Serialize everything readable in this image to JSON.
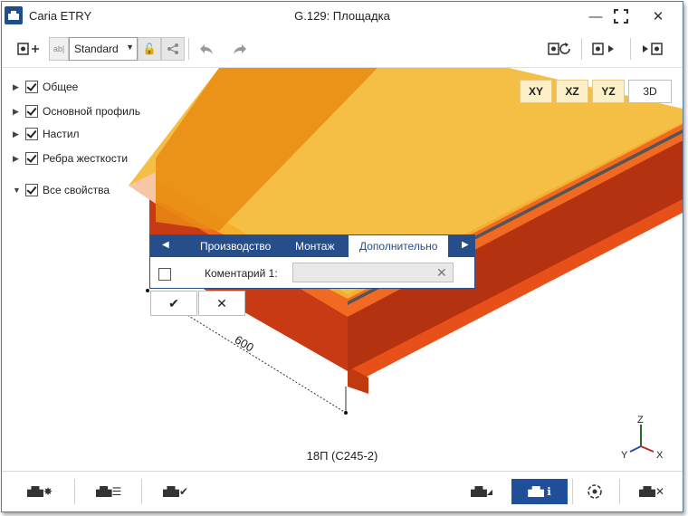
{
  "window": {
    "app_name": "Caria ETRY",
    "title": "G.129: Площадка"
  },
  "toolbar": {
    "style_value": "Standard",
    "ab_label": "ab|"
  },
  "view_buttons": [
    "XY",
    "XZ",
    "YZ",
    "3D"
  ],
  "tree": {
    "items": [
      {
        "label": "Общее",
        "expanded": false,
        "checked": true
      },
      {
        "label": "Основной профиль",
        "expanded": false,
        "checked": true
      },
      {
        "label": "Настил",
        "expanded": false,
        "checked": true
      },
      {
        "label": "Ребра жесткости",
        "expanded": false,
        "checked": true
      },
      {
        "label": "Все свойства",
        "expanded": true,
        "checked": true
      }
    ]
  },
  "panel": {
    "tabs": [
      "Производство",
      "Монтаж",
      "Дополнительно"
    ],
    "active_tab": "Дополнительно",
    "field_label": "Коментарий 1:",
    "field_value": ""
  },
  "dimension": {
    "value": "600"
  },
  "profile_label": "18П (С245-2)",
  "axes": {
    "z": "Z",
    "y": "Y",
    "x": "X"
  },
  "colors": {
    "accent": "#264e8b",
    "steel": "#e8501a",
    "deck": "#f2b62e"
  }
}
